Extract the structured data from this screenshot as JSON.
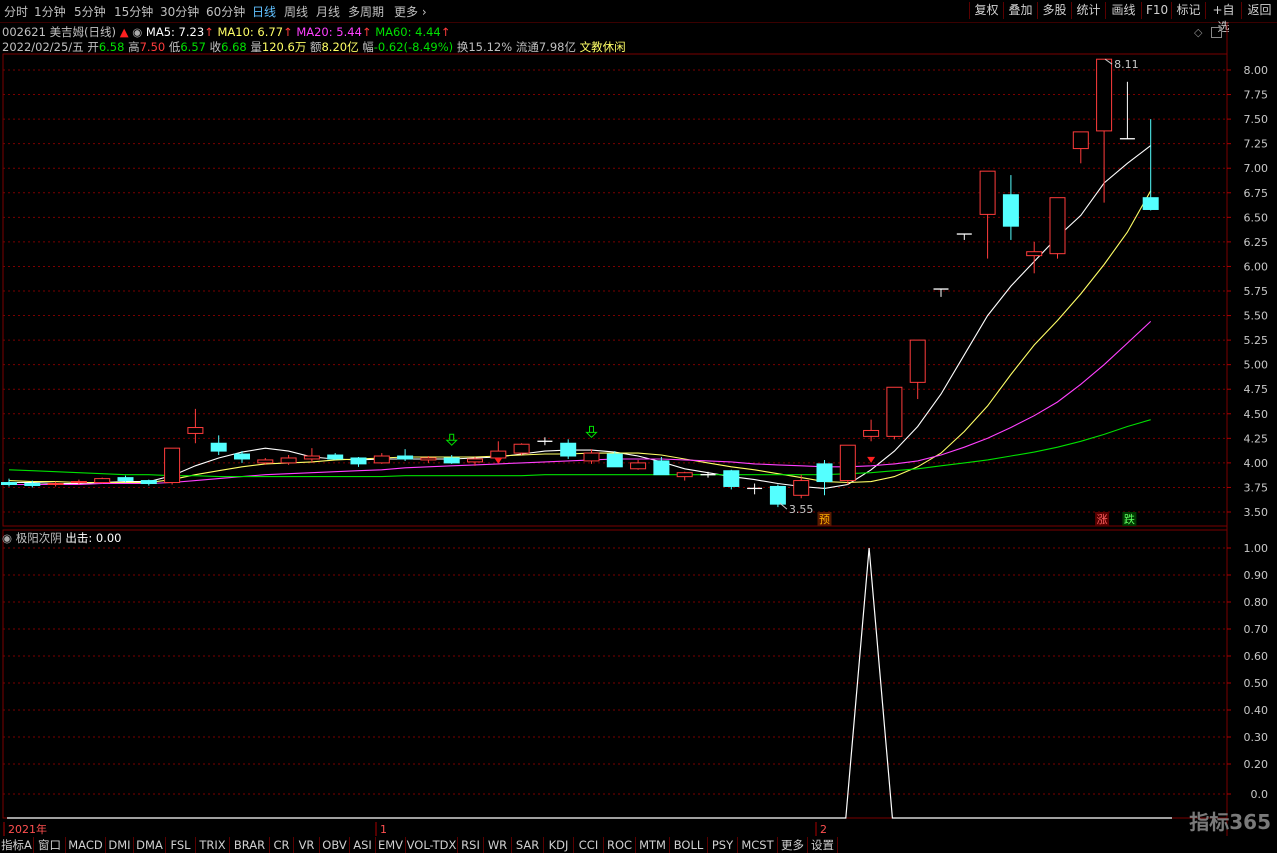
{
  "toolbar": {
    "periods": [
      "分时",
      "1分钟",
      "5分钟",
      "15分钟",
      "30分钟",
      "60分钟",
      "日线",
      "周线",
      "月线",
      "多周期",
      "更多"
    ],
    "active_period": "日线",
    "more_arrow": "›",
    "right_buttons": [
      "复权",
      "叠加",
      "多股",
      "统计",
      "画线",
      "F10",
      "标记",
      "+自选",
      "返回"
    ]
  },
  "header": {
    "code": "002621",
    "name": "美吉姆(日线)",
    "ma5": "MA5: 7.23",
    "ma10": "MA10: 6.77",
    "ma20": "MA20: 5.44",
    "ma60": "MA60: 4.44",
    "up_arrow": "↑",
    "date": "2022/02/25/五",
    "open_label": "开",
    "open": "6.58",
    "high_label": "高",
    "high": "7.50",
    "low_label": "低",
    "low": "6.57",
    "close_label": "收",
    "close": "6.68",
    "vol_label": "量",
    "vol": "120.6万",
    "amt_label": "额",
    "amt": "8.20亿",
    "chg_label": "幅",
    "chg": "-0.62(-8.49%)",
    "turn_label": "换",
    "turn": "15.12%",
    "float_label": "流通",
    "float": "7.98亿",
    "sector": "文教休闲"
  },
  "indicator": {
    "name": "极阳次阴",
    "output": "出击: 0.00"
  },
  "colors": {
    "up": "#ff3c3c",
    "down": "#54ffff",
    "ma5": "#ffffff",
    "ma10": "#ffff66",
    "ma20": "#ff40ff",
    "ma60": "#00e000",
    "grid": "#7a0000"
  },
  "chart_data": [
    {
      "type": "candlestick",
      "title": "002621 美吉姆(日线)",
      "ylim": [
        3.4,
        8.3
      ],
      "y_ticks": [
        "8.00",
        "7.75",
        "7.50",
        "7.25",
        "7.00",
        "6.75",
        "6.50",
        "6.25",
        "6.00",
        "5.75",
        "5.50",
        "5.25",
        "5.00",
        "4.75",
        "4.50",
        "4.25",
        "4.00",
        "3.75",
        "3.50"
      ],
      "x_labels": [
        "2021年",
        "1",
        "2"
      ],
      "annotations": [
        "3.55",
        "8.11",
        "预",
        "涨",
        "跌"
      ],
      "candles": [
        {
          "o": 3.8,
          "h": 3.84,
          "l": 3.76,
          "c": 3.78
        },
        {
          "o": 3.79,
          "h": 3.82,
          "l": 3.75,
          "c": 3.77
        },
        {
          "o": 3.78,
          "h": 3.81,
          "l": 3.76,
          "c": 3.79
        },
        {
          "o": 3.8,
          "h": 3.83,
          "l": 3.78,
          "c": 3.81
        },
        {
          "o": 3.8,
          "h": 3.85,
          "l": 3.79,
          "c": 3.84
        },
        {
          "o": 3.85,
          "h": 3.87,
          "l": 3.8,
          "c": 3.82
        },
        {
          "o": 3.82,
          "h": 3.83,
          "l": 3.77,
          "c": 3.79
        },
        {
          "o": 3.8,
          "h": 4.15,
          "l": 3.78,
          "c": 4.15
        },
        {
          "o": 4.3,
          "h": 4.55,
          "l": 4.2,
          "c": 4.36
        },
        {
          "o": 4.2,
          "h": 4.28,
          "l": 4.08,
          "c": 4.12
        },
        {
          "o": 4.09,
          "h": 4.12,
          "l": 4.0,
          "c": 4.04
        },
        {
          "o": 4.0,
          "h": 4.05,
          "l": 3.98,
          "c": 4.03
        },
        {
          "o": 4.0,
          "h": 4.08,
          "l": 3.98,
          "c": 4.05
        },
        {
          "o": 4.04,
          "h": 4.15,
          "l": 4.0,
          "c": 4.07
        },
        {
          "o": 4.08,
          "h": 4.1,
          "l": 4.03,
          "c": 4.04
        },
        {
          "o": 4.05,
          "h": 4.06,
          "l": 3.96,
          "c": 3.99
        },
        {
          "o": 4.0,
          "h": 4.1,
          "l": 3.99,
          "c": 4.07
        },
        {
          "o": 4.07,
          "h": 4.14,
          "l": 4.02,
          "c": 4.04
        },
        {
          "o": 4.03,
          "h": 4.07,
          "l": 4.0,
          "c": 4.05
        },
        {
          "o": 4.05,
          "h": 4.08,
          "l": 3.99,
          "c": 4.0
        },
        {
          "o": 4.01,
          "h": 4.06,
          "l": 3.97,
          "c": 4.04
        },
        {
          "o": 4.05,
          "h": 4.22,
          "l": 4.03,
          "c": 4.12
        },
        {
          "o": 4.1,
          "h": 4.2,
          "l": 4.08,
          "c": 4.19
        },
        {
          "o": 4.22,
          "h": 4.26,
          "l": 4.18,
          "c": 4.22
        },
        {
          "o": 4.2,
          "h": 4.24,
          "l": 4.04,
          "c": 4.07
        },
        {
          "o": 4.02,
          "h": 4.14,
          "l": 3.99,
          "c": 4.1
        },
        {
          "o": 4.09,
          "h": 4.12,
          "l": 3.97,
          "c": 3.96
        },
        {
          "o": 3.94,
          "h": 4.03,
          "l": 3.93,
          "c": 4.0
        },
        {
          "o": 4.02,
          "h": 4.06,
          "l": 3.95,
          "c": 3.88
        },
        {
          "o": 3.86,
          "h": 3.91,
          "l": 3.82,
          "c": 3.9
        },
        {
          "o": 3.88,
          "h": 3.91,
          "l": 3.85,
          "c": 3.87
        },
        {
          "o": 3.92,
          "h": 3.93,
          "l": 3.73,
          "c": 3.76
        },
        {
          "o": 3.74,
          "h": 3.79,
          "l": 3.68,
          "c": 3.74
        },
        {
          "o": 3.76,
          "h": 3.78,
          "l": 3.55,
          "c": 3.58
        },
        {
          "o": 3.67,
          "h": 3.88,
          "l": 3.64,
          "c": 3.82
        },
        {
          "o": 3.99,
          "h": 4.03,
          "l": 3.67,
          "c": 3.81
        },
        {
          "o": 3.82,
          "h": 4.18,
          "l": 3.78,
          "c": 4.18
        },
        {
          "o": 4.27,
          "h": 4.44,
          "l": 4.22,
          "c": 4.33
        },
        {
          "o": 4.27,
          "h": 4.77,
          "l": 4.24,
          "c": 4.77
        },
        {
          "o": 4.82,
          "h": 5.25,
          "l": 4.65,
          "c": 5.25
        },
        {
          "o": 5.77,
          "h": 5.77,
          "l": 5.69,
          "c": 5.77
        },
        {
          "o": 6.33,
          "h": 6.33,
          "l": 6.27,
          "c": 6.33
        },
        {
          "o": 6.53,
          "h": 6.97,
          "l": 6.08,
          "c": 6.97
        },
        {
          "o": 6.73,
          "h": 6.93,
          "l": 6.27,
          "c": 6.41
        },
        {
          "o": 6.11,
          "h": 6.25,
          "l": 5.93,
          "c": 6.15
        },
        {
          "o": 6.13,
          "h": 6.7,
          "l": 6.08,
          "c": 6.7
        },
        {
          "o": 7.2,
          "h": 7.35,
          "l": 7.05,
          "c": 7.37
        },
        {
          "o": 7.38,
          "h": 8.11,
          "l": 6.65,
          "c": 8.11
        },
        {
          "o": 7.3,
          "h": 7.88,
          "l": 7.3,
          "c": 7.3
        },
        {
          "o": 6.7,
          "h": 7.5,
          "l": 6.57,
          "c": 6.58
        }
      ],
      "series": [
        {
          "name": "MA5",
          "values": [
            3.8,
            3.8,
            3.79,
            3.79,
            3.8,
            3.81,
            3.81,
            3.87,
            3.97,
            4.05,
            4.11,
            4.15,
            4.12,
            4.06,
            4.04,
            4.03,
            4.04,
            4.04,
            4.04,
            4.04,
            4.05,
            4.06,
            4.09,
            4.12,
            4.13,
            4.13,
            4.11,
            4.07,
            4.01,
            3.94,
            3.9,
            3.86,
            3.83,
            3.79,
            3.76,
            3.74,
            3.78,
            3.93,
            4.12,
            4.37,
            4.7,
            5.1,
            5.5,
            5.8,
            6.05,
            6.3,
            6.52,
            6.85,
            7.05,
            7.23
          ]
        },
        {
          "name": "MA10",
          "values": [
            3.82,
            3.81,
            3.81,
            3.8,
            3.8,
            3.8,
            3.8,
            3.83,
            3.88,
            3.92,
            3.96,
            3.99,
            4.0,
            4.01,
            4.03,
            4.04,
            4.05,
            4.06,
            4.06,
            4.06,
            4.06,
            4.07,
            4.08,
            4.09,
            4.09,
            4.1,
            4.1,
            4.1,
            4.08,
            4.04,
            4.0,
            3.96,
            3.93,
            3.89,
            3.85,
            3.81,
            3.8,
            3.81,
            3.86,
            3.96,
            4.1,
            4.32,
            4.58,
            4.9,
            5.2,
            5.45,
            5.72,
            6.02,
            6.35,
            6.77
          ]
        },
        {
          "name": "MA20",
          "values": [
            3.78,
            3.78,
            3.78,
            3.78,
            3.79,
            3.79,
            3.79,
            3.8,
            3.82,
            3.84,
            3.86,
            3.88,
            3.89,
            3.9,
            3.91,
            3.92,
            3.93,
            3.95,
            3.96,
            3.97,
            3.98,
            3.99,
            4.0,
            4.01,
            4.02,
            4.03,
            4.04,
            4.04,
            4.04,
            4.03,
            4.02,
            4.01,
            3.99,
            3.98,
            3.97,
            3.96,
            3.96,
            3.97,
            3.99,
            4.02,
            4.08,
            4.16,
            4.25,
            4.36,
            4.48,
            4.62,
            4.8,
            5.0,
            5.22,
            5.44
          ]
        },
        {
          "name": "MA60",
          "values": [
            3.93,
            3.92,
            3.91,
            3.9,
            3.89,
            3.88,
            3.88,
            3.87,
            3.87,
            3.86,
            3.86,
            3.86,
            3.86,
            3.86,
            3.86,
            3.86,
            3.86,
            3.87,
            3.87,
            3.87,
            3.87,
            3.87,
            3.87,
            3.88,
            3.88,
            3.88,
            3.88,
            3.88,
            3.88,
            3.88,
            3.88,
            3.88,
            3.88,
            3.88,
            3.88,
            3.88,
            3.89,
            3.9,
            3.92,
            3.94,
            3.97,
            4.0,
            4.03,
            4.07,
            4.11,
            4.16,
            4.22,
            4.29,
            4.37,
            4.44
          ]
        }
      ]
    },
    {
      "type": "line",
      "title": "极阳次阴",
      "ylim": [
        0,
        1.1
      ],
      "y_ticks": [
        "1.00",
        "0.90",
        "0.80",
        "0.70",
        "0.60",
        "0.50",
        "0.40",
        "0.30",
        "0.20",
        "0.0"
      ],
      "series": [
        {
          "name": "出击",
          "values": [
            0,
            0,
            0,
            0,
            0,
            0,
            0,
            0,
            0,
            0,
            0,
            0,
            0,
            0,
            0,
            0,
            0,
            0,
            0,
            0,
            0,
            0,
            0,
            0,
            0,
            0,
            0,
            0,
            0,
            0,
            0,
            0,
            0,
            0,
            0,
            0,
            0,
            1,
            0,
            0,
            0,
            0,
            0,
            0,
            0,
            0,
            0,
            0,
            0,
            0,
            0
          ]
        }
      ]
    }
  ],
  "bottom_tabs": [
    "指标A",
    "窗口",
    "MACD",
    "DMI",
    "DMA",
    "FSL",
    "TRIX",
    "BRAR",
    "CR",
    "VR",
    "OBV",
    "ASI",
    "EMV",
    "VOL-TDX",
    "RSI",
    "WR",
    "SAR",
    "KDJ",
    "CCI",
    "ROC",
    "MTM",
    "BOLL",
    "PSY",
    "MCST",
    "更多",
    "设置"
  ],
  "logo": "指标365"
}
